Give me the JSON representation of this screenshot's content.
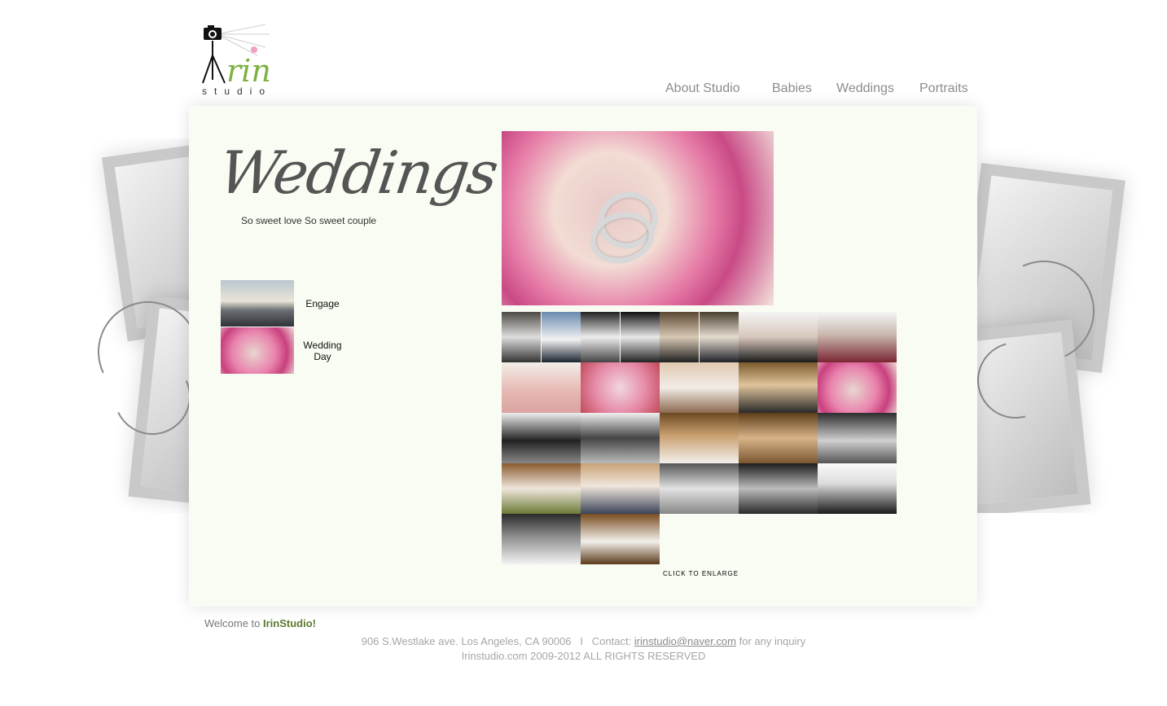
{
  "brand": {
    "logo_text": "rin",
    "logo_sub": "studio"
  },
  "nav": [
    {
      "label": "About Studio"
    },
    {
      "label": "Babies"
    },
    {
      "label": "Weddings"
    },
    {
      "label": "Portraits"
    }
  ],
  "section": {
    "title": "Weddings",
    "tagline": "So sweet love So sweet couple"
  },
  "albums": [
    {
      "label": "Engage"
    },
    {
      "label": "Wedding Day"
    }
  ],
  "gallery": {
    "enlarge_label": "CLICK TO ENLARGE"
  },
  "footer": {
    "welcome_prefix": "Welcome to ",
    "welcome_name": "IrinStudio!",
    "address": "906 S.Westlake ave. Los Angeles, CA 90006   I   Contact: ",
    "email": "irinstudio@naver.com",
    "inquiry": " for any inquiry",
    "copyright": "Irinstudio.com 2009-2012 ALL RIGHTS RESERVED"
  }
}
